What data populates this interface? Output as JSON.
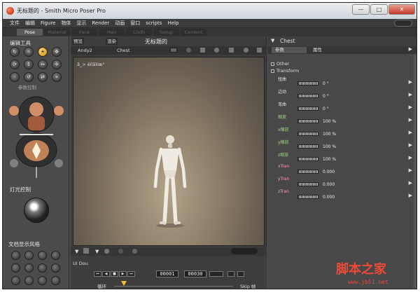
{
  "window": {
    "title": "无标题的 - Smith Micro Poser Pro",
    "controls": {
      "minimize": "—",
      "maximize": "□",
      "close": "✕"
    }
  },
  "menu": {
    "items": [
      "文件",
      "编辑",
      "Figure",
      "物体",
      "显示",
      "Render",
      "动画",
      "窗口",
      "scripts",
      "Help"
    ]
  },
  "rooms": {
    "tabs": [
      "Pose",
      "Material",
      "Face",
      "Hair",
      "Cloth",
      "Setup",
      "Content"
    ],
    "active": "Pose"
  },
  "left_panel": {
    "edit_tools_label": "编辑工具",
    "tools": [
      "↻",
      "☼",
      "☀",
      "✥",
      "⟳",
      "↕",
      "↔",
      "✛",
      "☝",
      "↺",
      "⇄",
      "⌖"
    ],
    "parameter_dials_label": "参数控制",
    "lighting_label": "灯光控制",
    "doc_style_label": "文档显示风格"
  },
  "document": {
    "tabs": [
      "预览",
      "渲染"
    ],
    "title": "无标题的",
    "camera_menu": "Andy2",
    "body_part_menu": "Chest",
    "viewport_label": "â_> ëílãìlæ°",
    "ui_dots_label": "UI Dou",
    "loop_label": "循环",
    "skip_label": "Skip 帧",
    "current_frame": "00001",
    "total_frames": "00030",
    "playback_buttons": [
      "⏮",
      "◀",
      "■",
      "▶",
      "⏭"
    ]
  },
  "parameters": {
    "header": "Chest",
    "tabs": [
      "参数",
      "属性"
    ],
    "active_tab": "参数",
    "groups": [
      "Other",
      "Transform"
    ],
    "rows": [
      {
        "name": "扭曲",
        "value": "0 °",
        "color": "default"
      },
      {
        "name": "边动",
        "value": "0 °",
        "color": "default"
      },
      {
        "name": "弯曲",
        "value": "0 °",
        "color": "default"
      },
      {
        "name": "缩放",
        "value": "100 %",
        "color": "green"
      },
      {
        "name": "x缩放",
        "value": "100 %",
        "color": "green"
      },
      {
        "name": "y缩放",
        "value": "100 %",
        "color": "green"
      },
      {
        "name": "z缩放",
        "value": "100 %",
        "color": "green"
      },
      {
        "name": "xTran",
        "value": "0.000",
        "color": "pink"
      },
      {
        "name": "yTran",
        "value": "0.000",
        "color": "pink"
      },
      {
        "name": "zTran",
        "value": "0.000",
        "color": "pink"
      }
    ]
  },
  "watermark": {
    "title": "脚本之家",
    "url": "www.jb51.net"
  },
  "colors": {
    "ui_dark": "#3d3d3d",
    "ui_mid": "#4b4b4b",
    "scene_warm": "#b1a48a",
    "accent_yellow": "#f4c542",
    "watermark_red": "#ee4a39"
  }
}
